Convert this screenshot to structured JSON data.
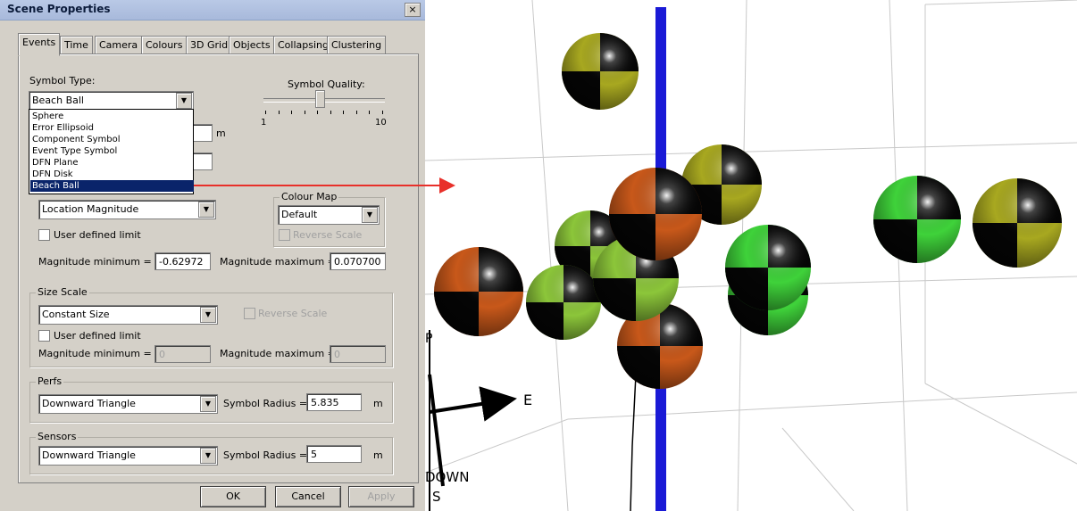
{
  "dialog": {
    "title": "Scene Properties",
    "close_label": "×",
    "tabs": [
      "Events",
      "Time",
      "Camera",
      "Colours",
      "3D Grid",
      "Objects",
      "Collapsing",
      "Clustering"
    ],
    "active_tab": "Events",
    "symbol_type_label": "Symbol Type:",
    "symbol_type_value": "Beach Ball",
    "symbol_type_options": [
      "Sphere",
      "Error Ellipsoid",
      "Component Symbol",
      "Event Type Symbol",
      "DFN Plane",
      "DFN Disk",
      "Beach Ball"
    ],
    "symbol_quality_label": "Symbol Quality:",
    "symbol_quality_min": "1",
    "symbol_quality_max": "10",
    "symbol_quality_value": 0.45,
    "hidden_unit_m": "m",
    "colour_scale_value": "Location Magnitude",
    "colour_map_label": "Colour Map",
    "colour_map_value": "Default",
    "reverse_scale_label": "Reverse Scale",
    "user_defined_limit_label": "User defined limit",
    "magnitude_minimum_label": "Magnitude minimum =",
    "magnitude_minimum_value": "-0.62972",
    "magnitude_maximum_label": "Magnitude maximum =",
    "magnitude_maximum_value": "0.070700",
    "size_scale": {
      "title": "Size Scale",
      "value": "Constant Size",
      "reverse_scale_label": "Reverse Scale",
      "user_defined_limit_label": "User defined limit",
      "magnitude_minimum_label": "Magnitude minimum =",
      "magnitude_minimum_value": "0",
      "magnitude_maximum_label": "Magnitude maximum =",
      "magnitude_maximum_value": "0"
    },
    "perfs": {
      "title": "Perfs",
      "value": "Downward Triangle",
      "radius_label": "Symbol Radius =",
      "radius_value": "5.835",
      "unit": "m"
    },
    "sensors": {
      "title": "Sensors",
      "value": "Downward Triangle",
      "radius_label": "Symbol Radius =",
      "radius_value": "5",
      "unit": "m"
    },
    "buttons": {
      "ok": "OK",
      "cancel": "Cancel",
      "apply": "Apply"
    }
  },
  "scene": {
    "axis_labels": {
      "east": "E",
      "down": "DOWN",
      "south": "S",
      "partial": "P"
    },
    "colors": {
      "well": "#1a1ad6",
      "arrow": "#e8302a",
      "green": "#3fd23a",
      "olive": "#a8a820",
      "orange": "#c8581a",
      "lime": "#8cc63a"
    }
  }
}
